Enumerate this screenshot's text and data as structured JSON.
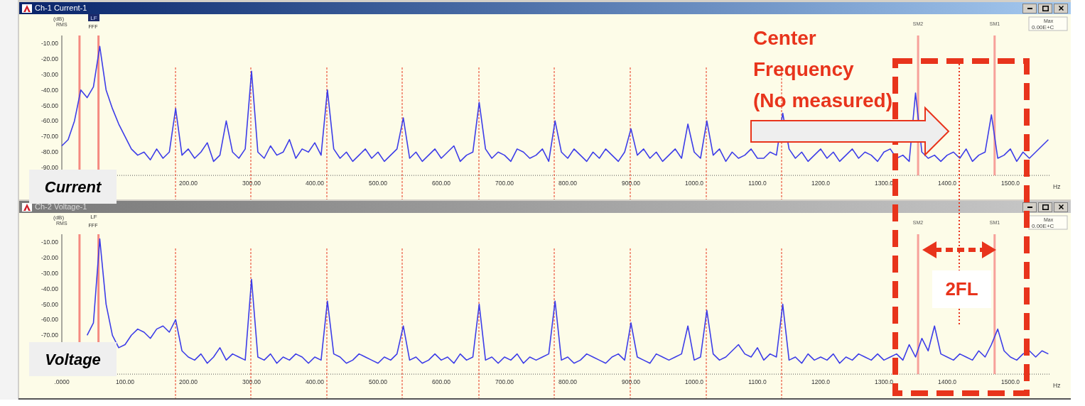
{
  "windows": [
    {
      "title": "Ch-1 Current-1",
      "active": true,
      "unit_label": "(dB)",
      "unit_sub": "RMS",
      "lf": {
        "label": "LF",
        "highlighted": true
      },
      "peak_marks": "FFF",
      "marker_labels": [
        "SM2",
        "SM1"
      ],
      "readout": {
        "label": "Max",
        "value": "0.00E+C"
      },
      "caption": "Current",
      "chart_data": {
        "type": "line",
        "xlabel": "Hz",
        "xlim": [
          0,
          1560
        ],
        "ylim": [
          -95,
          -5
        ],
        "ref_lines": [
          {
            "axis": "x",
            "value": 28,
            "color": "#f58a80"
          },
          {
            "axis": "x",
            "value": 58,
            "color": "#f58a80"
          },
          {
            "axis": "x",
            "value": 1354,
            "color": "#f7a09a"
          },
          {
            "axis": "x",
            "value": 1475,
            "color": "#f7a09a"
          }
        ],
        "yticks": [
          {
            "value": -10,
            "label": "-10.00"
          },
          {
            "value": -20,
            "label": "-20.00"
          },
          {
            "value": -30,
            "label": "-30.00"
          },
          {
            "value": -40,
            "label": "-40.00"
          },
          {
            "value": -50,
            "label": "-50.00"
          },
          {
            "value": -60,
            "label": "-60.00"
          },
          {
            "value": -70,
            "label": "-70.00"
          },
          {
            "value": -80,
            "label": "-80.00"
          },
          {
            "value": -90,
            "label": "-90.00"
          }
        ],
        "xticks": [
          {
            "value": 200,
            "label": "200.00"
          },
          {
            "value": 300,
            "label": "300.00"
          },
          {
            "value": 400,
            "label": "400.00"
          },
          {
            "value": 500,
            "label": "500.00"
          },
          {
            "value": 600,
            "label": "600.00"
          },
          {
            "value": 700,
            "label": "700.00"
          },
          {
            "value": 800,
            "label": "800.00"
          },
          {
            "value": 900,
            "label": "900.00"
          },
          {
            "value": 1000,
            "label": "1000.0"
          },
          {
            "value": 1100,
            "label": "1100.0"
          },
          {
            "value": 1200,
            "label": "1200.0"
          },
          {
            "value": 1300,
            "label": "1300.0"
          },
          {
            "value": 1400,
            "label": "1400.0"
          },
          {
            "value": 1500,
            "label": "1500.0"
          }
        ],
        "x": [
          0,
          10,
          20,
          30,
          40,
          50,
          60,
          70,
          80,
          90,
          100,
          110,
          120,
          130,
          140,
          150,
          160,
          170,
          180,
          190,
          200,
          210,
          220,
          230,
          240,
          250,
          260,
          270,
          280,
          290,
          300,
          310,
          320,
          330,
          340,
          350,
          360,
          370,
          380,
          390,
          400,
          410,
          420,
          430,
          440,
          450,
          460,
          470,
          480,
          490,
          500,
          510,
          520,
          530,
          540,
          550,
          560,
          570,
          580,
          590,
          600,
          610,
          620,
          630,
          640,
          650,
          660,
          670,
          680,
          690,
          700,
          710,
          720,
          730,
          740,
          750,
          760,
          770,
          780,
          790,
          800,
          810,
          820,
          830,
          840,
          850,
          860,
          870,
          880,
          890,
          900,
          910,
          920,
          930,
          940,
          950,
          960,
          970,
          980,
          990,
          1000,
          1010,
          1020,
          1030,
          1040,
          1050,
          1060,
          1070,
          1080,
          1090,
          1100,
          1110,
          1120,
          1130,
          1140,
          1150,
          1160,
          1170,
          1180,
          1190,
          1200,
          1210,
          1220,
          1230,
          1240,
          1250,
          1260,
          1270,
          1280,
          1290,
          1300,
          1310,
          1320,
          1330,
          1340,
          1350,
          1360,
          1370,
          1380,
          1390,
          1400,
          1410,
          1420,
          1430,
          1440,
          1450,
          1460,
          1470,
          1480,
          1490,
          1500,
          1510,
          1520,
          1530,
          1540,
          1550,
          1560
        ],
        "series": [
          {
            "color": "#3d3de8",
            "values": [
              -76,
              -72,
              -60,
              -40,
              -45,
              -38,
              -12,
              -40,
              -52,
              -62,
              -70,
              -78,
              -82,
              -80,
              -85,
              -78,
              -84,
              -80,
              -52,
              -82,
              -78,
              -84,
              -80,
              -74,
              -86,
              -82,
              -60,
              -80,
              -84,
              -78,
              -28,
              -80,
              -84,
              -76,
              -82,
              -80,
              -72,
              -84,
              -78,
              -80,
              -74,
              -82,
              -40,
              -78,
              -84,
              -80,
              -86,
              -82,
              -78,
              -84,
              -80,
              -86,
              -82,
              -78,
              -58,
              -84,
              -80,
              -86,
              -82,
              -78,
              -84,
              -80,
              -76,
              -86,
              -82,
              -80,
              -48,
              -78,
              -84,
              -80,
              -82,
              -86,
              -78,
              -80,
              -84,
              -82,
              -78,
              -86,
              -60,
              -80,
              -84,
              -78,
              -82,
              -86,
              -80,
              -84,
              -78,
              -82,
              -86,
              -80,
              -65,
              -82,
              -78,
              -84,
              -80,
              -86,
              -82,
              -78,
              -84,
              -62,
              -80,
              -84,
              -60,
              -82,
              -78,
              -86,
              -80,
              -84,
              -82,
              -78,
              -84,
              -84,
              -80,
              -82,
              -55,
              -78,
              -84,
              -80,
              -86,
              -82,
              -78,
              -84,
              -80,
              -86,
              -82,
              -78,
              -84,
              -80,
              -82,
              -86,
              -80,
              -78,
              -84,
              -82,
              -86,
              -42,
              -80,
              -84,
              -82,
              -86,
              -82,
              -80,
              -84,
              -78,
              -86,
              -82,
              -80,
              -56,
              -84,
              -82,
              -78,
              -86,
              -80,
              -84,
              -80,
              -76,
              -72
            ]
          }
        ]
      }
    },
    {
      "title": "Ch-2 Voltage-1",
      "active": false,
      "unit_label": "(dB)",
      "unit_sub": "RMS",
      "lf": {
        "label": "LF",
        "highlighted": false
      },
      "peak_marks": "FFF",
      "marker_labels": [
        "SM2",
        "SM1"
      ],
      "readout": {
        "label": "Max",
        "value": "0.00E+C"
      },
      "caption": "Voltage",
      "chart_data": {
        "type": "line",
        "xlabel": "Hz",
        "xlim": [
          0,
          1560
        ],
        "ylim": [
          -95,
          -5
        ],
        "ref_lines": [
          {
            "axis": "x",
            "value": 28,
            "color": "#f58a80"
          },
          {
            "axis": "x",
            "value": 58,
            "color": "#f58a80"
          },
          {
            "axis": "x",
            "value": 1354,
            "color": "#f7a09a"
          },
          {
            "axis": "x",
            "value": 1475,
            "color": "#f7a09a"
          }
        ],
        "yticks": [
          {
            "value": -10,
            "label": "-10.00"
          },
          {
            "value": -20,
            "label": "-20.00"
          },
          {
            "value": -30,
            "label": "-30.00"
          },
          {
            "value": -40,
            "label": "-40.00"
          },
          {
            "value": -50,
            "label": "-50.00"
          },
          {
            "value": -60,
            "label": "-60.00"
          },
          {
            "value": -70,
            "label": "-70.00"
          }
        ],
        "xticks": [
          {
            "value": 0,
            "label": ".0000"
          },
          {
            "value": 100,
            "label": "100.00"
          },
          {
            "value": 200,
            "label": "200.00"
          },
          {
            "value": 300,
            "label": "300.00"
          },
          {
            "value": 400,
            "label": "400.00"
          },
          {
            "value": 500,
            "label": "500.00"
          },
          {
            "value": 600,
            "label": "600.00"
          },
          {
            "value": 700,
            "label": "700.00"
          },
          {
            "value": 800,
            "label": "800.00"
          },
          {
            "value": 900,
            "label": "900.00"
          },
          {
            "value": 1000,
            "label": "1000.0"
          },
          {
            "value": 1100,
            "label": "1100.0"
          },
          {
            "value": 1200,
            "label": "1200.0"
          },
          {
            "value": 1300,
            "label": "1300.0"
          },
          {
            "value": 1400,
            "label": "1400.0"
          },
          {
            "value": 1500,
            "label": "1500.0"
          }
        ],
        "x": [
          40,
          50,
          60,
          70,
          80,
          90,
          100,
          110,
          120,
          130,
          140,
          150,
          160,
          170,
          180,
          190,
          200,
          210,
          220,
          230,
          240,
          250,
          260,
          270,
          280,
          290,
          300,
          310,
          320,
          330,
          340,
          350,
          360,
          370,
          380,
          390,
          400,
          410,
          420,
          430,
          440,
          450,
          460,
          470,
          480,
          490,
          500,
          510,
          520,
          530,
          540,
          550,
          560,
          570,
          580,
          590,
          600,
          610,
          620,
          630,
          640,
          650,
          660,
          670,
          680,
          690,
          700,
          710,
          720,
          730,
          740,
          750,
          760,
          770,
          780,
          790,
          800,
          810,
          820,
          830,
          840,
          850,
          860,
          870,
          880,
          890,
          900,
          910,
          920,
          930,
          940,
          950,
          960,
          970,
          980,
          990,
          1000,
          1010,
          1020,
          1030,
          1040,
          1050,
          1060,
          1070,
          1080,
          1090,
          1100,
          1110,
          1120,
          1130,
          1140,
          1150,
          1160,
          1170,
          1180,
          1190,
          1200,
          1210,
          1220,
          1230,
          1240,
          1250,
          1260,
          1270,
          1280,
          1290,
          1300,
          1310,
          1320,
          1330,
          1340,
          1350,
          1360,
          1370,
          1380,
          1390,
          1400,
          1410,
          1420,
          1430,
          1440,
          1450,
          1460,
          1470,
          1480,
          1490,
          1500,
          1510,
          1520,
          1530,
          1540,
          1550,
          1560
        ],
        "series": [
          {
            "color": "#3d3de8",
            "values": [
              -70,
              -62,
              -8,
              -50,
              -70,
              -78,
              -76,
              -70,
              -66,
              -68,
              -72,
              -66,
              -64,
              -68,
              -60,
              -80,
              -84,
              -86,
              -82,
              -88,
              -84,
              -78,
              -86,
              -82,
              -84,
              -86,
              -34,
              -84,
              -86,
              -82,
              -88,
              -84,
              -86,
              -82,
              -84,
              -88,
              -84,
              -86,
              -48,
              -82,
              -84,
              -88,
              -86,
              -82,
              -84,
              -86,
              -88,
              -84,
              -86,
              -82,
              -64,
              -86,
              -84,
              -88,
              -86,
              -82,
              -86,
              -84,
              -88,
              -82,
              -86,
              -84,
              -50,
              -86,
              -84,
              -88,
              -84,
              -86,
              -82,
              -88,
              -84,
              -86,
              -84,
              -82,
              -48,
              -86,
              -84,
              -88,
              -86,
              -82,
              -84,
              -86,
              -88,
              -84,
              -82,
              -86,
              -62,
              -84,
              -86,
              -88,
              -82,
              -84,
              -86,
              -84,
              -82,
              -64,
              -86,
              -84,
              -54,
              -82,
              -86,
              -84,
              -80,
              -76,
              -82,
              -84,
              -78,
              -86,
              -82,
              -84,
              -50,
              -86,
              -84,
              -88,
              -82,
              -86,
              -84,
              -86,
              -82,
              -88,
              -84,
              -86,
              -82,
              -84,
              -86,
              -82,
              -86,
              -84,
              -82,
              -86,
              -76,
              -84,
              -72,
              -80,
              -64,
              -82,
              -84,
              -86,
              -82,
              -84,
              -86,
              -80,
              -84,
              -76,
              -66,
              -80,
              -84,
              -86,
              -82,
              -80,
              -84,
              -80,
              -82
            ]
          }
        ]
      }
    }
  ],
  "annotations": {
    "center_note": "Center\nFrequency\n(No measured)",
    "band_label": "2FL"
  }
}
